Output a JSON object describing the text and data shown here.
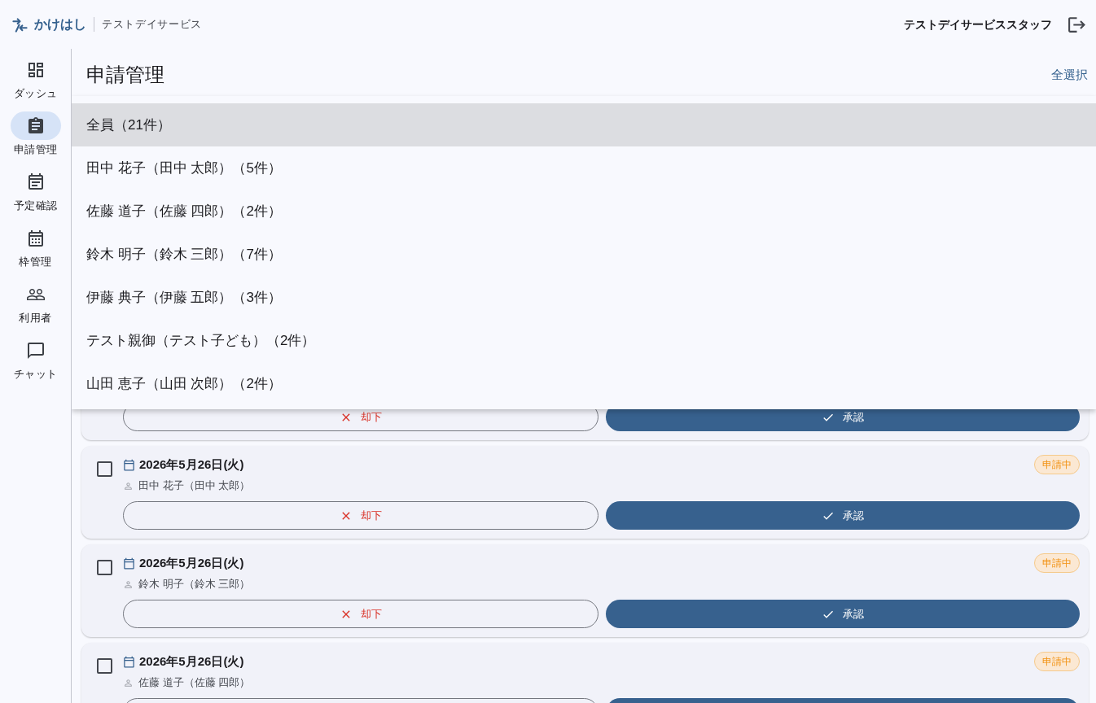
{
  "header": {
    "logo": "かけはし",
    "facility": "テストデイサービス",
    "user": "テストデイサービススタッフ"
  },
  "sidebar": {
    "items": [
      {
        "label": "ダッシュ",
        "selected": false
      },
      {
        "label": "申請管理",
        "selected": true
      },
      {
        "label": "予定確認",
        "selected": false
      },
      {
        "label": "枠管理",
        "selected": false
      },
      {
        "label": "利用者",
        "selected": false
      },
      {
        "label": "チャット",
        "selected": false
      }
    ]
  },
  "page": {
    "title": "申請管理",
    "select_all": "全選択"
  },
  "menu": {
    "items": [
      {
        "label": "全員（21件）",
        "selected": true
      },
      {
        "label": "田中 花子（田中 太郎）（5件）",
        "selected": false
      },
      {
        "label": "佐藤 道子（佐藤 四郎）（2件）",
        "selected": false
      },
      {
        "label": "鈴木 明子（鈴木 三郎）（7件）",
        "selected": false
      },
      {
        "label": "伊藤 典子（伊藤 五郎）（3件）",
        "selected": false
      },
      {
        "label": "テスト親御（テスト子ども）（2件）",
        "selected": false
      },
      {
        "label": "山田 恵子（山田 次郎）（2件）",
        "selected": false
      }
    ]
  },
  "requests": [
    {
      "actions": [
        {
          "kind": "reject",
          "label": "却下"
        },
        {
          "kind": "approve",
          "label": "承認"
        }
      ]
    },
    {
      "checked": false,
      "date": "2026年5月26日(火)",
      "person": "田中 花子（田中 太郎）",
      "status": "申請中",
      "actions": [
        {
          "kind": "reject",
          "label": "却下"
        },
        {
          "kind": "approve",
          "label": "承認"
        }
      ]
    },
    {
      "checked": false,
      "date": "2026年5月26日(火)",
      "person": "鈴木 明子（鈴木 三郎）",
      "status": "申請中",
      "actions": [
        {
          "kind": "reject",
          "label": "却下"
        },
        {
          "kind": "approve",
          "label": "承認"
        }
      ]
    },
    {
      "checked": false,
      "date": "2026年5月26日(火)",
      "person": "佐藤 道子（佐藤 四郎）",
      "status": "申請中",
      "actions": [
        {
          "kind": "reject"
        },
        {
          "kind": "approve"
        }
      ]
    }
  ]
}
